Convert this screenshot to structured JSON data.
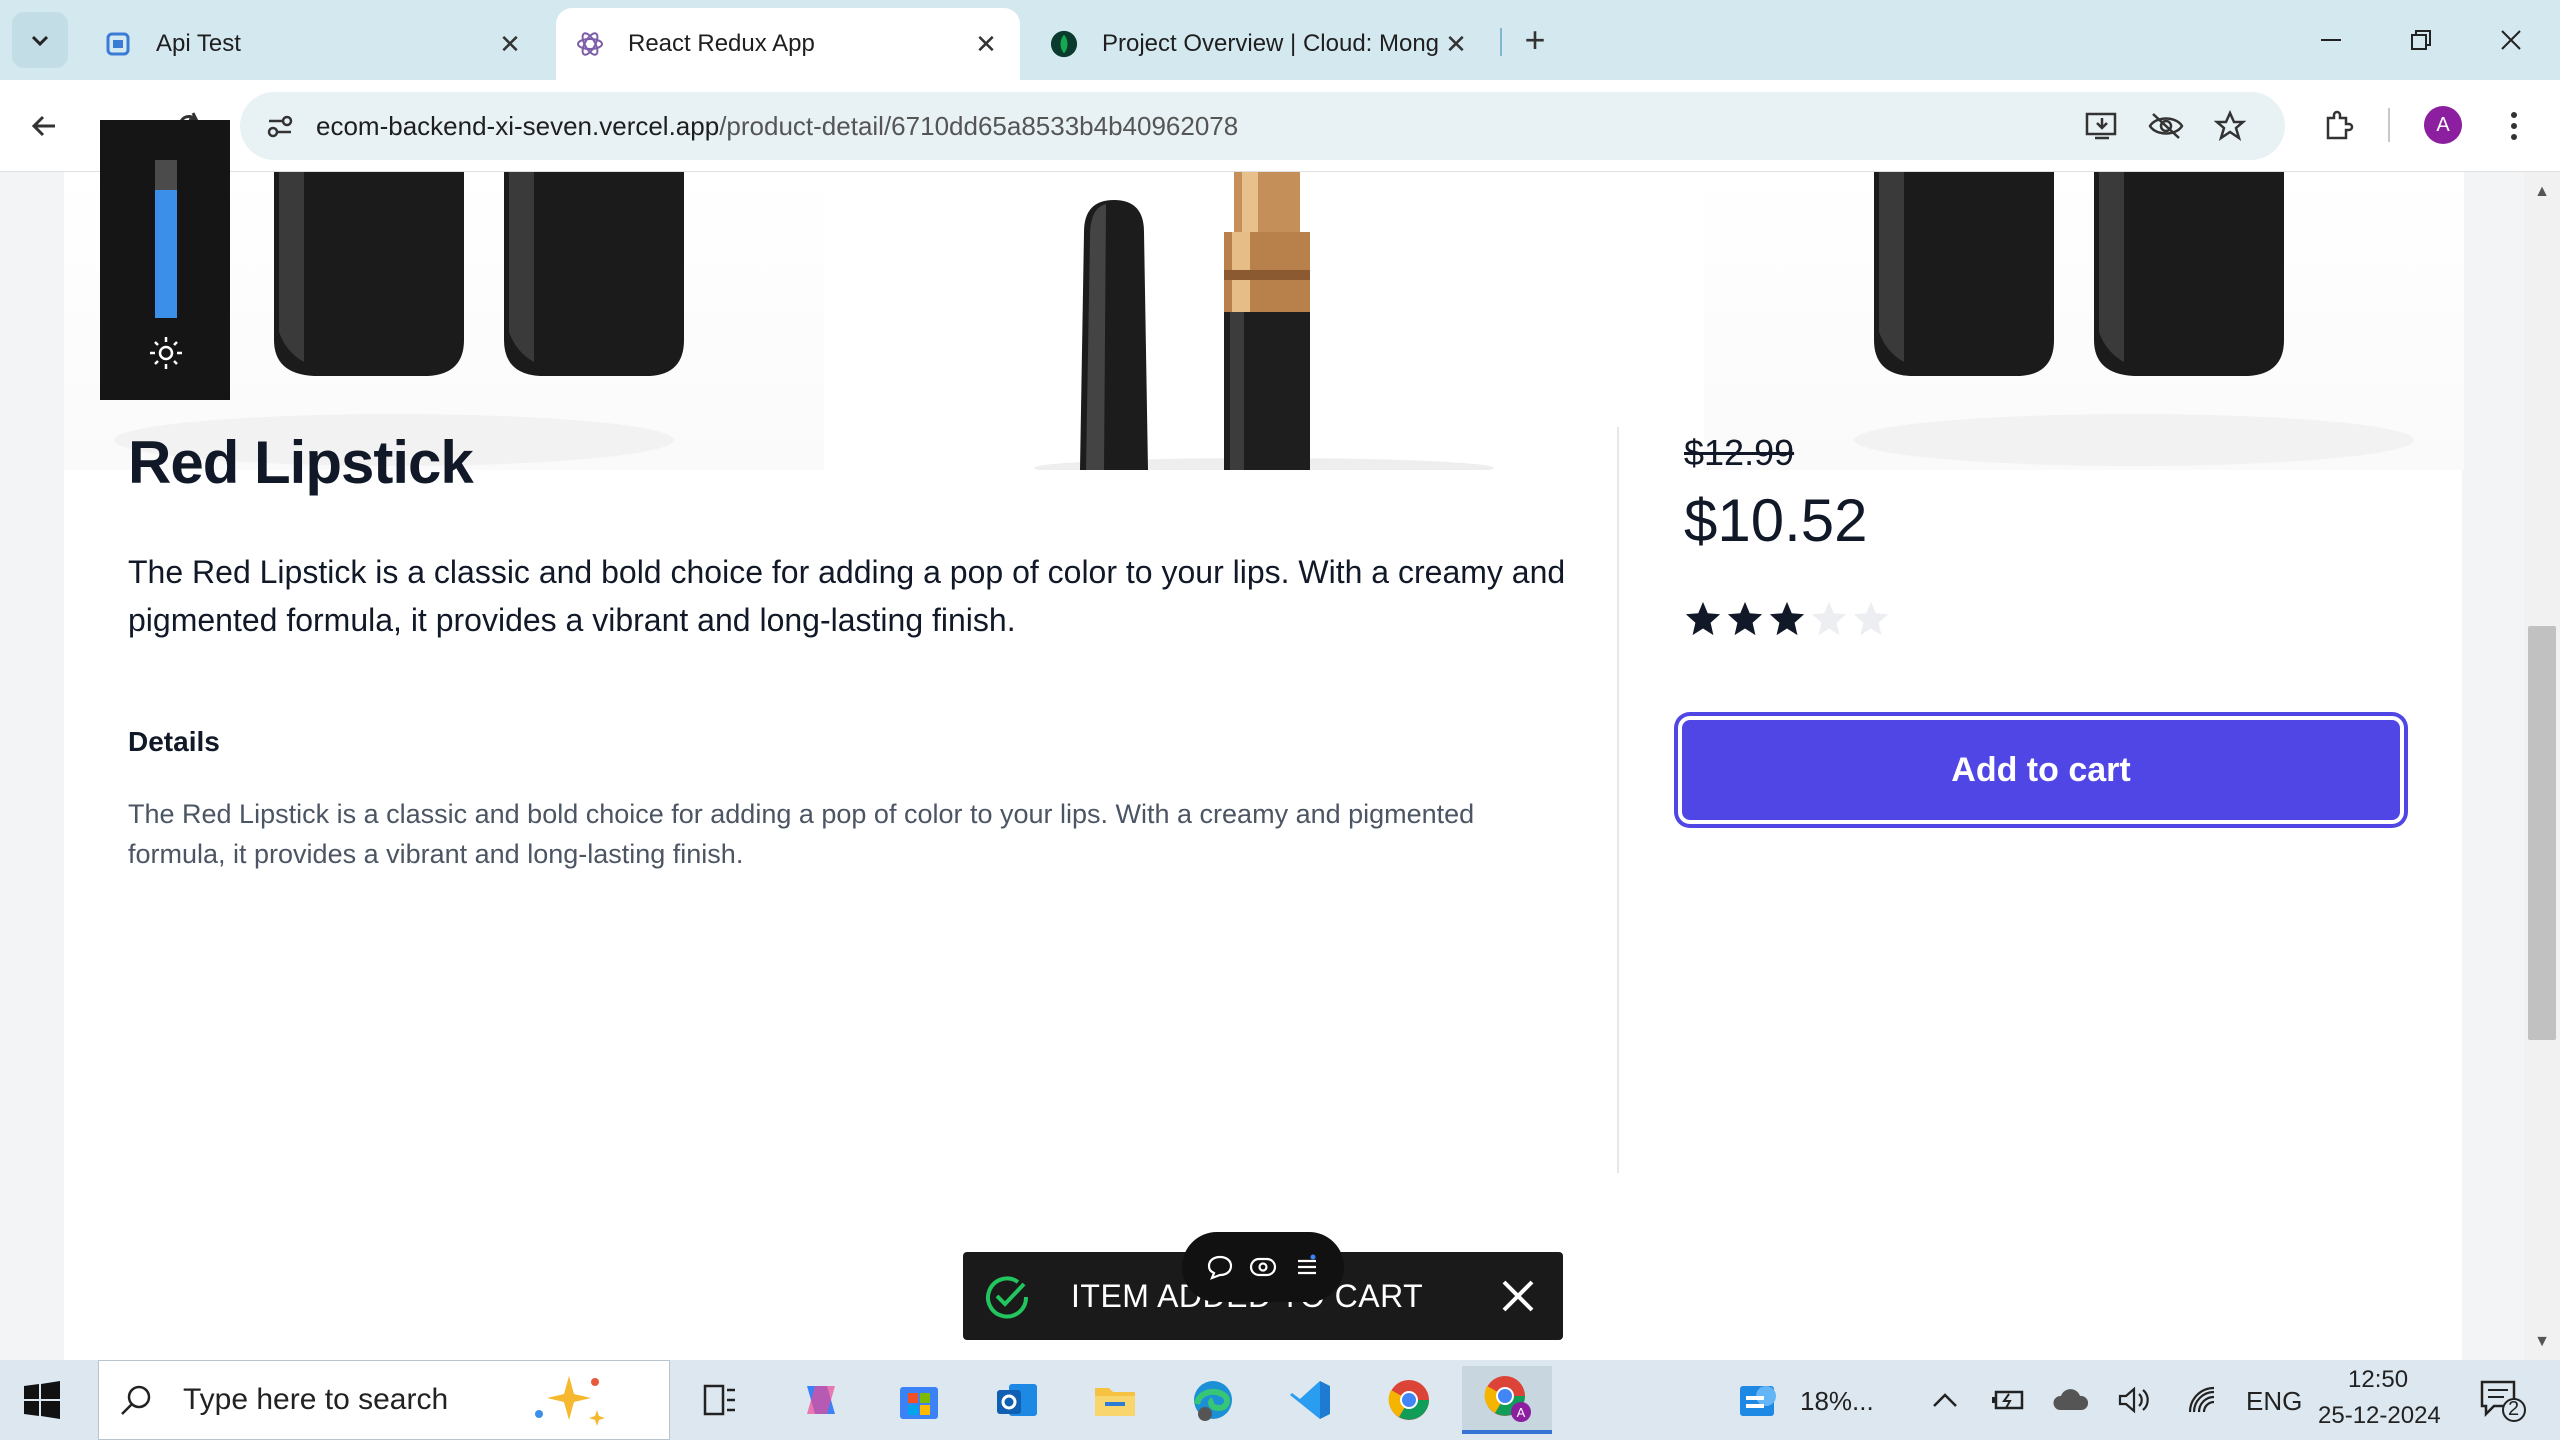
{
  "browser": {
    "tabs": [
      {
        "title": "Api Test",
        "active": false
      },
      {
        "title": "React Redux App",
        "active": true
      },
      {
        "title": "Project Overview | Cloud: Mong",
        "active": false
      }
    ],
    "url_host": "ecom-backend-xi-seven.vercel.app",
    "url_path": "/product-detail/6710dd65a8533b4b40962078",
    "profile_initial": "A"
  },
  "product": {
    "title": "Red Lipstick",
    "description": "The Red Lipstick is a classic and bold choice for adding a pop of color to your lips. With a creamy and pigmented formula, it provides a vibrant and long-lasting finish.",
    "details_heading": "Details",
    "details_text": "The Red Lipstick is a classic and bold choice for adding a pop of color to your lips. With a creamy and pigmented formula, it provides a vibrant and long-lasting finish.",
    "original_price": "$12.99",
    "price": "$10.52",
    "rating": 3,
    "rating_max": 5,
    "add_to_cart_label": "Add to cart"
  },
  "toast": {
    "message": "ITEM ADDED TO CART"
  },
  "brightness_level": 0.81,
  "taskbar": {
    "search_placeholder": "Type here to search",
    "weather_text": "18%...",
    "language": "ENG",
    "time": "12:50",
    "date": "25-12-2024",
    "notification_count": "2"
  },
  "colors": {
    "accent": "#4f46e5",
    "tabstrip": "#d4e8ef",
    "toast_bg": "#1a1a1a",
    "check_green": "#22c55e"
  }
}
